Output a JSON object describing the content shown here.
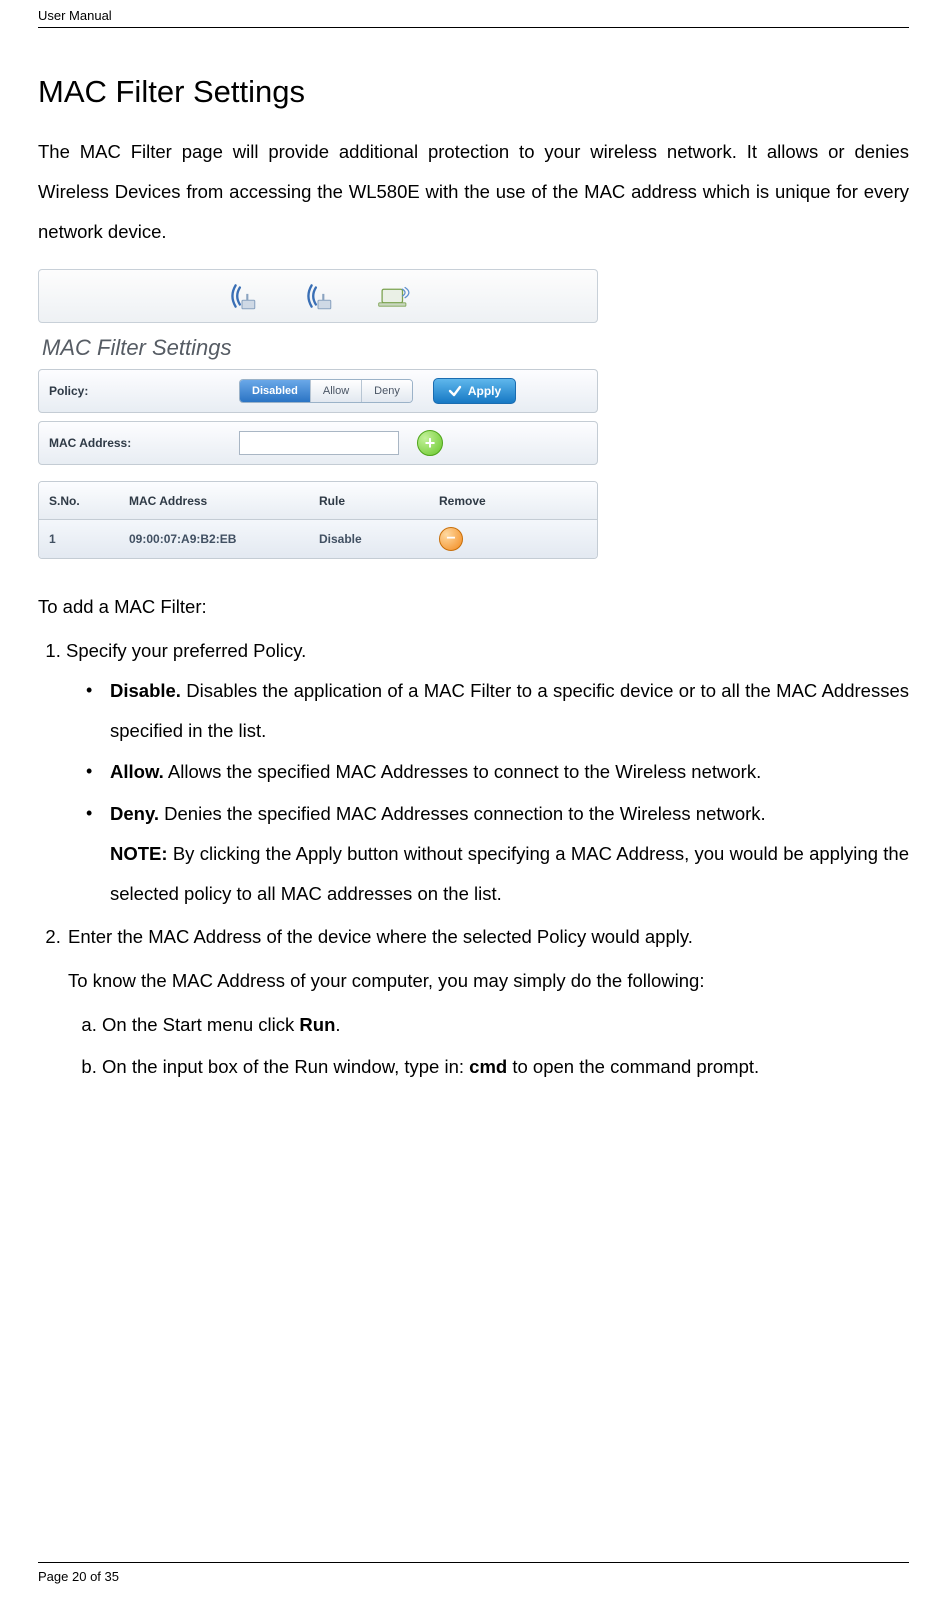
{
  "header": {
    "title": "User Manual"
  },
  "page": {
    "title": "MAC Filter Settings",
    "intro": "The MAC Filter page will provide additional protection to your wireless network. It allows or denies Wireless Devices from accessing the WL580E with the use of the MAC address which is unique for every network device."
  },
  "screenshot": {
    "panel_title": "MAC Filter Settings",
    "policy": {
      "label": "Policy:",
      "options": [
        "Disabled",
        "Allow",
        "Deny"
      ],
      "active": "Disabled",
      "apply_label": "Apply"
    },
    "mac_row": {
      "label": "MAC Address:",
      "value": ""
    },
    "table": {
      "headers": {
        "sno": "S.No.",
        "mac": "MAC Address",
        "rule": "Rule",
        "remove": "Remove"
      },
      "rows": [
        {
          "sno": "1",
          "mac": "09:00:07:A9:B2:EB",
          "rule": "Disable"
        }
      ]
    }
  },
  "instructions": {
    "lead": "To add a MAC Filter:",
    "step1": "Specify your preferred Policy.",
    "bullets": {
      "disable_label": "Disable.",
      "disable_text": " Disables the application of a MAC Filter to a specific device or to all the MAC Addresses specified in the list.",
      "allow_label": "Allow.",
      "allow_text": " Allows the specified MAC Addresses to connect to the Wireless network.",
      "deny_label": "Deny.",
      "deny_text": " Denies the specified MAC Addresses connection to the Wireless network.",
      "note_label": "NOTE:",
      "note_text": " By clicking the Apply button without specifying a MAC Address, you would be applying the selected policy to all MAC addresses on the list."
    },
    "step2": "Enter the MAC Address of the device where the selected Policy would apply.",
    "step2_sub": "To know the MAC Address of your computer, you may simply do the following:",
    "sub_a_pre": "On the Start menu click ",
    "sub_a_bold": "Run",
    "sub_a_post": ".",
    "sub_b_pre": "On the input box of the Run window, type in: ",
    "sub_b_bold": "cmd",
    "sub_b_post": " to open the command prompt."
  },
  "footer": {
    "page_label_pre": "Page ",
    "current": "20",
    "of": " of ",
    "total": "35"
  }
}
